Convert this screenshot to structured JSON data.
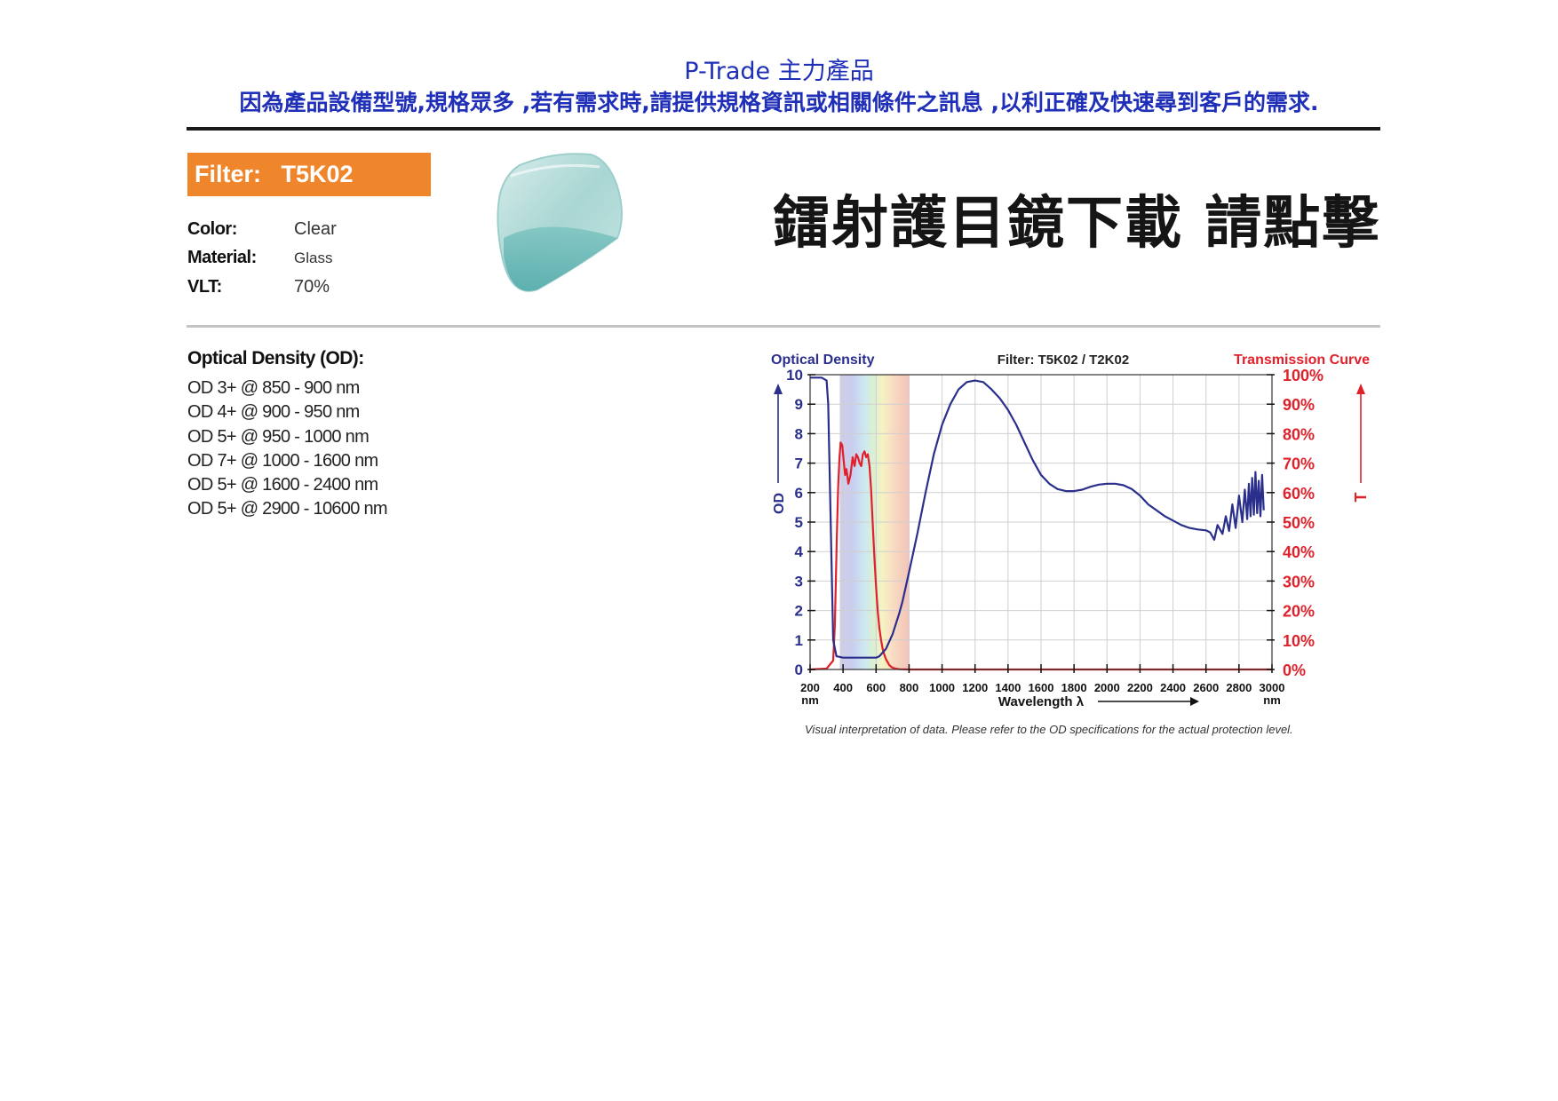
{
  "header": {
    "brand": "P-Trade 主力產品",
    "notice": "因為產品設備型號,規格眾多 ,若有需求時,請提供規格資訊或相關條件之訊息 ,以利正確及快速尋到客戶的需求."
  },
  "product": {
    "filter_label": "Filter:",
    "filter_id": "T5K02",
    "properties": [
      {
        "key": "Color:",
        "value": "Clear"
      },
      {
        "key": "Material:",
        "value": "Glass"
      },
      {
        "key": "VLT:",
        "value": "70%"
      }
    ],
    "download_link": "鐳射護目鏡下載 請點擊"
  },
  "optical_density": {
    "title": "Optical Density (OD):",
    "specs": [
      "OD 3+ @ 850 - 900 nm",
      "OD 4+ @ 900 - 950 nm",
      "OD 5+ @ 950 - 1000 nm",
      "OD 7+ @ 1000 - 1600 nm",
      "OD 5+ @ 1600 - 2400 nm",
      "OD 5+ @ 2900 - 10600 nm"
    ]
  },
  "colors": {
    "header_blue": "#1f2fb8",
    "badge_orange": "#f0862b",
    "od_curve": "#2a2f8c",
    "transmission_curve": "#e0202a"
  },
  "chart_data": {
    "type": "line",
    "title": "Filter: T5K02 / T2K02",
    "left_axis_title": "Optical Density",
    "right_axis_title": "Transmission Curve",
    "ylabel": "OD",
    "y2label": "T",
    "xlabel": "Wavelength λ",
    "x_unit": "nm",
    "xlim": [
      200,
      3000
    ],
    "ylim": [
      0,
      10
    ],
    "y2lim": [
      0,
      100
    ],
    "x_ticks": [
      "200",
      "400",
      "600",
      "800",
      "1000",
      "1200",
      "1400",
      "1600",
      "1800",
      "2000",
      "2200",
      "2400",
      "2600",
      "2800",
      "3000"
    ],
    "y_ticks": [
      "0",
      "1",
      "2",
      "3",
      "4",
      "5",
      "6",
      "7",
      "8",
      "9",
      "10"
    ],
    "y2_ticks": [
      "0%",
      "10%",
      "20%",
      "30%",
      "40%",
      "50%",
      "60%",
      "70%",
      "80%",
      "90%",
      "100%"
    ],
    "grid": true,
    "series": [
      {
        "axis": "left",
        "color": "#2a2f8c",
        "x": [
          200,
          270,
          300,
          310,
          325,
          340,
          360,
          400,
          500,
          600,
          620,
          660,
          700,
          740,
          760,
          800,
          850,
          900,
          950,
          1000,
          1050,
          1100,
          1150,
          1200,
          1250,
          1300,
          1350,
          1400,
          1450,
          1500,
          1550,
          1600,
          1650,
          1700,
          1750,
          1800,
          1850,
          1900,
          1950,
          2000,
          2050,
          2100,
          2150,
          2200,
          2250,
          2300,
          2350,
          2400,
          2450,
          2500,
          2550,
          2600,
          2625,
          2650,
          2670,
          2700,
          2720,
          2740,
          2760,
          2780,
          2800,
          2820,
          2835,
          2850,
          2860,
          2870,
          2880,
          2890,
          2900,
          2910,
          2920,
          2930,
          2940,
          2950
        ],
        "values": [
          9.9,
          9.9,
          9.8,
          9.0,
          5.0,
          1.0,
          0.45,
          0.4,
          0.4,
          0.4,
          0.45,
          0.7,
          1.2,
          1.9,
          2.3,
          3.3,
          4.6,
          6.0,
          7.3,
          8.3,
          9.0,
          9.5,
          9.75,
          9.8,
          9.75,
          9.5,
          9.2,
          8.8,
          8.3,
          7.7,
          7.1,
          6.6,
          6.3,
          6.12,
          6.05,
          6.05,
          6.1,
          6.2,
          6.27,
          6.3,
          6.3,
          6.25,
          6.12,
          5.9,
          5.6,
          5.4,
          5.2,
          5.05,
          4.9,
          4.8,
          4.75,
          4.72,
          4.65,
          4.4,
          4.9,
          4.6,
          5.2,
          4.7,
          5.6,
          4.8,
          5.9,
          5.0,
          6.1,
          5.1,
          6.3,
          5.2,
          6.5,
          5.25,
          6.7,
          5.3,
          6.4,
          5.2,
          6.6,
          5.4
        ],
        "name": ""
      },
      {
        "axis": "right",
        "color": "#e0202a",
        "x": [
          200,
          300,
          340,
          350,
          362,
          370,
          378,
          385,
          395,
          405,
          412,
          420,
          432,
          445,
          458,
          470,
          480,
          490,
          500,
          510,
          520,
          530,
          540,
          550,
          560,
          570,
          580,
          590,
          600,
          610,
          620,
          630,
          640,
          650,
          660,
          670,
          680,
          690,
          700,
          720,
          740,
          760,
          800,
          1000,
          2000,
          3000
        ],
        "values": [
          0,
          0.3,
          3,
          15,
          45,
          62,
          72,
          77,
          76,
          70,
          66,
          68,
          63,
          66,
          72,
          69,
          73,
          72,
          70,
          69,
          73,
          74,
          72,
          73,
          69,
          61,
          49,
          38,
          28,
          20,
          14,
          10,
          7,
          5,
          3.5,
          2.5,
          1.5,
          1.0,
          0.6,
          0.3,
          0.1,
          0.05,
          0,
          0,
          0,
          0
        ],
        "name": ""
      }
    ],
    "caption": "Visual interpretation of data. Please refer to the OD specifications for the actual protection level."
  }
}
